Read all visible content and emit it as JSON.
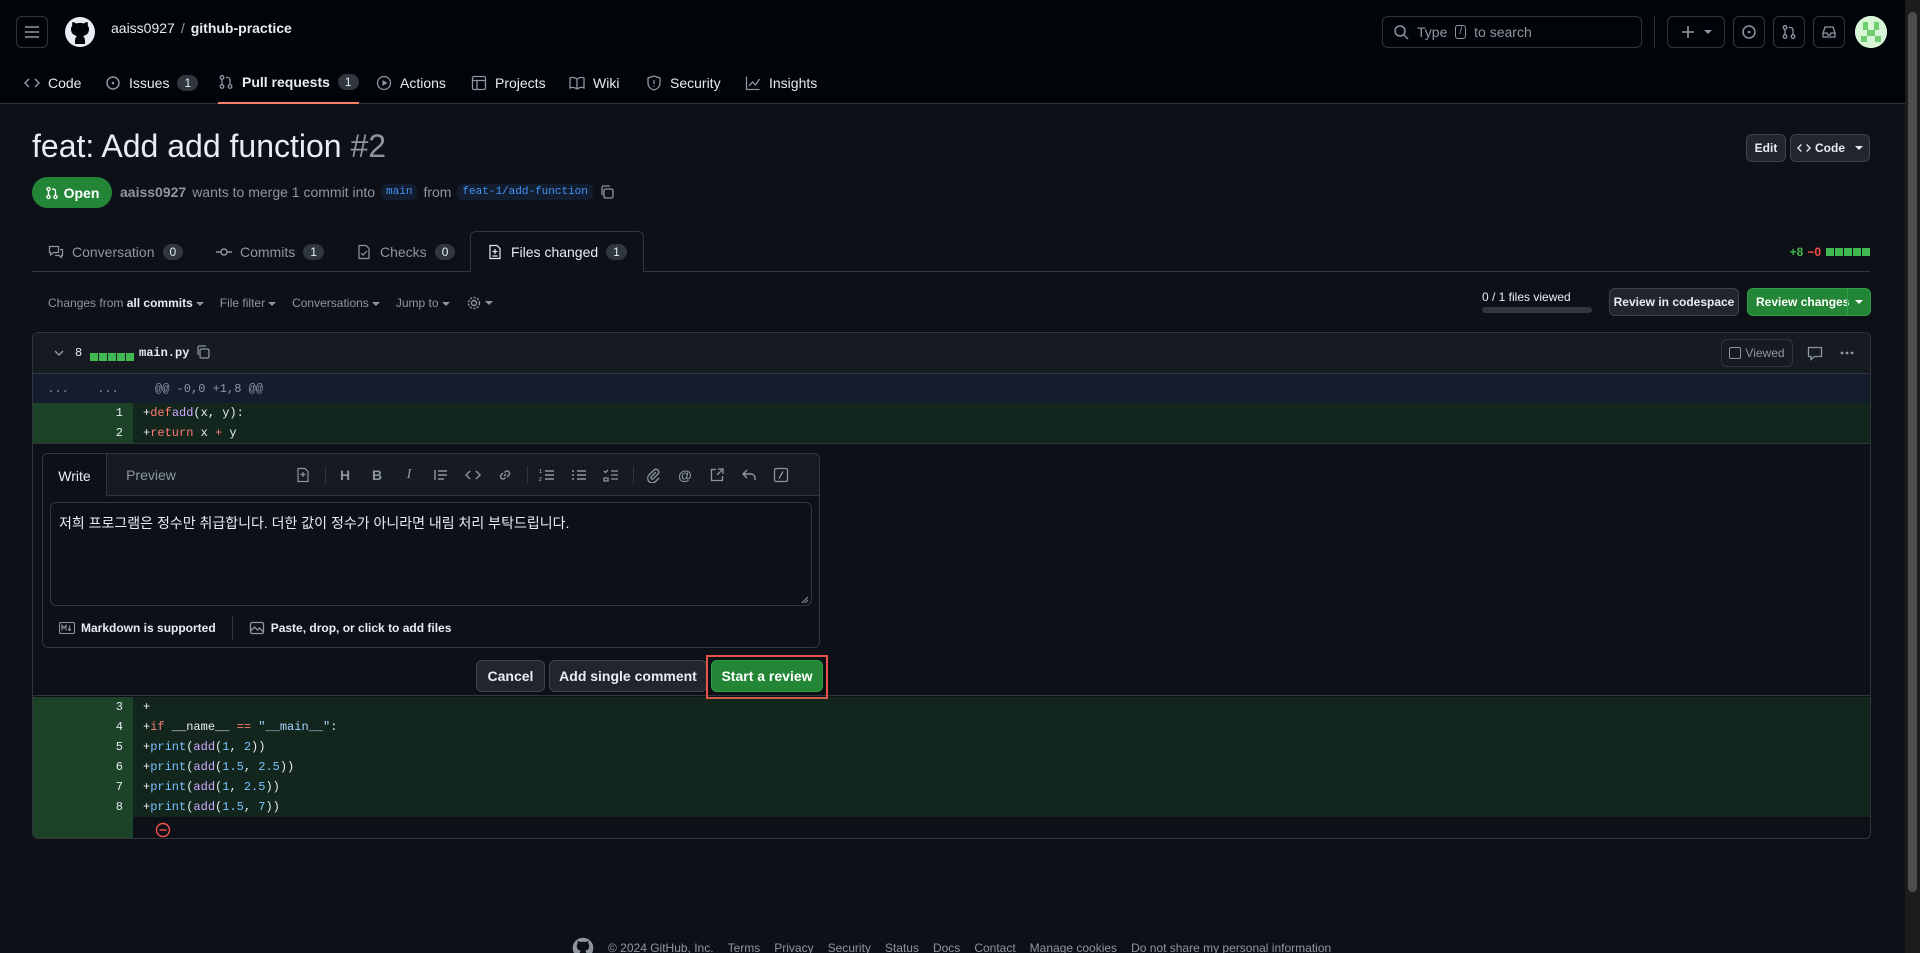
{
  "header": {
    "owner": "aaiss0927",
    "separator": "/",
    "repo": "github-practice",
    "search_placeholder": "Type",
    "search_kbd": "/",
    "search_suffix": "to search"
  },
  "repo_tabs": [
    {
      "label": "Code",
      "icon": "code-icon"
    },
    {
      "label": "Issues",
      "count": "1",
      "icon": "issue-icon"
    },
    {
      "label": "Pull requests",
      "count": "1",
      "icon": "pull-request-icon"
    },
    {
      "label": "Actions",
      "icon": "play-icon"
    },
    {
      "label": "Projects",
      "icon": "table-icon"
    },
    {
      "label": "Wiki",
      "icon": "book-icon"
    },
    {
      "label": "Security",
      "icon": "shield-icon"
    },
    {
      "label": "Insights",
      "icon": "graph-icon"
    }
  ],
  "pr": {
    "title": "feat: Add add function",
    "number": "#2",
    "state": "Open",
    "author": "aaiss0927",
    "merge_text": "wants to merge 1 commit into",
    "base_branch": "main",
    "from_text": "from",
    "head_branch": "feat-1/add-function",
    "edit_label": "Edit",
    "code_label": "Code"
  },
  "pr_tabs": [
    {
      "label": "Conversation",
      "count": "0"
    },
    {
      "label": "Commits",
      "count": "1"
    },
    {
      "label": "Checks",
      "count": "0"
    },
    {
      "label": "Files changed",
      "count": "1"
    }
  ],
  "diffstat": {
    "additions": "+8",
    "deletions": "−0"
  },
  "toolbar": {
    "changes_from": "Changes from",
    "all_commits": "all commits",
    "file_filter": "File filter",
    "conversations": "Conversations",
    "jump_to": "Jump to",
    "files_viewed": "0 / 1 files viewed",
    "review_codespace": "Review in codespace",
    "review_changes": "Review changes"
  },
  "file": {
    "changes": "8",
    "name": "main.py",
    "viewed_label": "Viewed",
    "hunk_left": "...",
    "hunk_right": "...",
    "hunk_header": "@@ -0,0 +1,8 @@"
  },
  "code_lines": [
    {
      "num": "1",
      "marker": "+"
    },
    {
      "num": "2",
      "marker": "+"
    },
    {
      "num": "3",
      "marker": "+"
    },
    {
      "num": "4",
      "marker": "+"
    },
    {
      "num": "5",
      "marker": "+"
    },
    {
      "num": "6",
      "marker": "+"
    },
    {
      "num": "7",
      "marker": "+"
    },
    {
      "num": "8",
      "marker": "+"
    }
  ],
  "code": {
    "l1_kw": "def",
    "l1_fn": "add",
    "l1_rest": "(x, y):",
    "l2_kw": "return",
    "l2_rest1": " x ",
    "l2_op": "+",
    "l2_rest2": " y",
    "l4_kw": "if",
    "l4_a": " __name__ ",
    "l4_op": "==",
    "l4_str": " \"__main__\"",
    "l4_end": ":",
    "print": "print",
    "add": "add",
    "l5_args": [
      "1",
      "2"
    ],
    "l6_args": [
      "1.5",
      "2.5"
    ],
    "l7_args": [
      "1",
      "2.5"
    ],
    "l8_args": [
      "1.5",
      "7"
    ]
  },
  "comment": {
    "write_tab": "Write",
    "preview_tab": "Preview",
    "text": "저희 프로그램은 정수만 취급합니다. 더한 값이 정수가 아니라면 내림 처리 부탁드립니다.",
    "markdown_note": "Markdown is supported",
    "attach_note": "Paste, drop, or click to add files",
    "cancel": "Cancel",
    "add_single": "Add single comment",
    "start_review": "Start a review",
    "highlight_color": "#e5534b"
  },
  "footer": {
    "copyright": "© 2024 GitHub, Inc.",
    "links": [
      "Terms",
      "Privacy",
      "Security",
      "Status",
      "Docs",
      "Contact",
      "Manage cookies",
      "Do not share my personal information"
    ]
  }
}
